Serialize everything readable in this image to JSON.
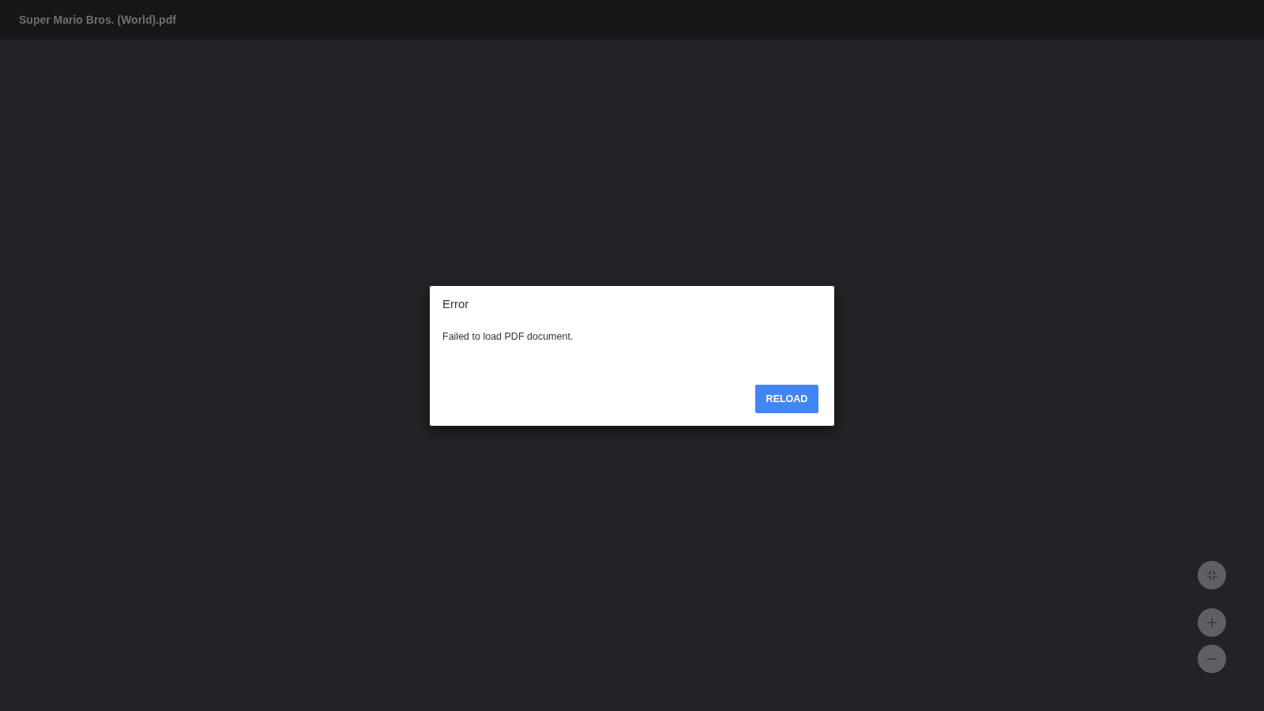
{
  "window": {
    "title": "Super Mario Bros. (World).pdf"
  },
  "dialog": {
    "title": "Error",
    "message": "Failed to load PDF document.",
    "button": "RELOAD"
  },
  "zoom_controls": [
    {
      "kind": "fit"
    },
    {
      "kind": "zoom-in"
    },
    {
      "kind": "zoom-out"
    }
  ]
}
